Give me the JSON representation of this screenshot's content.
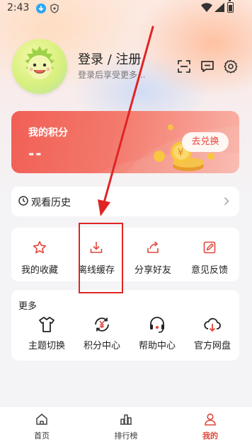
{
  "status_bar": {
    "time": "2:43"
  },
  "profile": {
    "login_title": "登录 / 注册",
    "login_subtitle": "登录后享受更多..."
  },
  "points_card": {
    "title": "我的积分",
    "value": "--",
    "redeem_label": "去兑换"
  },
  "history": {
    "label": "观看历史"
  },
  "quick_actions": [
    {
      "label": "我的收藏",
      "icon": "star-icon"
    },
    {
      "label": "离线缓存",
      "icon": "download-icon"
    },
    {
      "label": "分享好友",
      "icon": "share-icon"
    },
    {
      "label": "意见反馈",
      "icon": "edit-icon"
    }
  ],
  "more": {
    "title": "更多",
    "items": [
      {
        "label": "主题切换",
        "icon": "tshirt-icon"
      },
      {
        "label": "积分中心",
        "icon": "points-yen-icon"
      },
      {
        "label": "帮助中心",
        "icon": "headset-icon"
      },
      {
        "label": "官方网盘",
        "icon": "cloud-download-icon"
      }
    ]
  },
  "tabbar": [
    {
      "label": "首页",
      "icon": "home-icon",
      "active": false
    },
    {
      "label": "排行榜",
      "icon": "ranking-icon",
      "active": false
    },
    {
      "label": "我的",
      "icon": "profile-icon",
      "active": true
    }
  ],
  "colors": {
    "accent": "#e2463b",
    "highlight_annotation": "#e02424"
  }
}
